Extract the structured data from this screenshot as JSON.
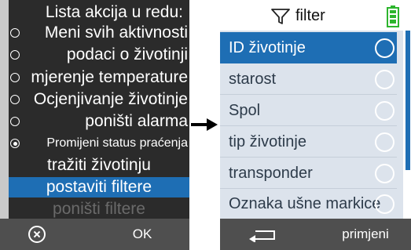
{
  "left_menu": {
    "title": "Lista akcija u redu:",
    "items": [
      {
        "label": "Meni svih aktivnosti",
        "radio": "off"
      },
      {
        "label": "podaci o životinji",
        "radio": "off"
      },
      {
        "label": "mjerenje temperature",
        "radio": "off"
      },
      {
        "label": "Ocjenjivanje životinje",
        "radio": "off"
      },
      {
        "label": "poništi alarma",
        "radio": "off"
      },
      {
        "label": "Promijeni status praćenja",
        "radio": "on"
      },
      {
        "label": "tražiti životinju"
      },
      {
        "label": "postaviti filtere",
        "state": "selected"
      },
      {
        "label": "poništi filtere",
        "state": "disabled"
      }
    ],
    "bottom": {
      "cancel_icon": "cancel-circle-icon",
      "ok_label": "OK"
    }
  },
  "right_panel": {
    "header": {
      "title": "filter",
      "filter_icon": "funnel-icon",
      "battery_icon": "battery-icon"
    },
    "items": [
      {
        "label": "ID životinje",
        "state": "selected"
      },
      {
        "label": "starost"
      },
      {
        "label": "Spol"
      },
      {
        "label": "tip životinje"
      },
      {
        "label": "transponder"
      },
      {
        "label": "Oznaka ušne markice"
      }
    ],
    "bottom": {
      "back_icon": "back-arrow-icon",
      "apply_label": "primjeni"
    }
  },
  "colors": {
    "accent": "#1e6eb4",
    "left_background": "#2b2b2b",
    "bottom_bar": "#4f4f4f",
    "list_background": "#dce3ec",
    "battery": "#2db52d"
  }
}
